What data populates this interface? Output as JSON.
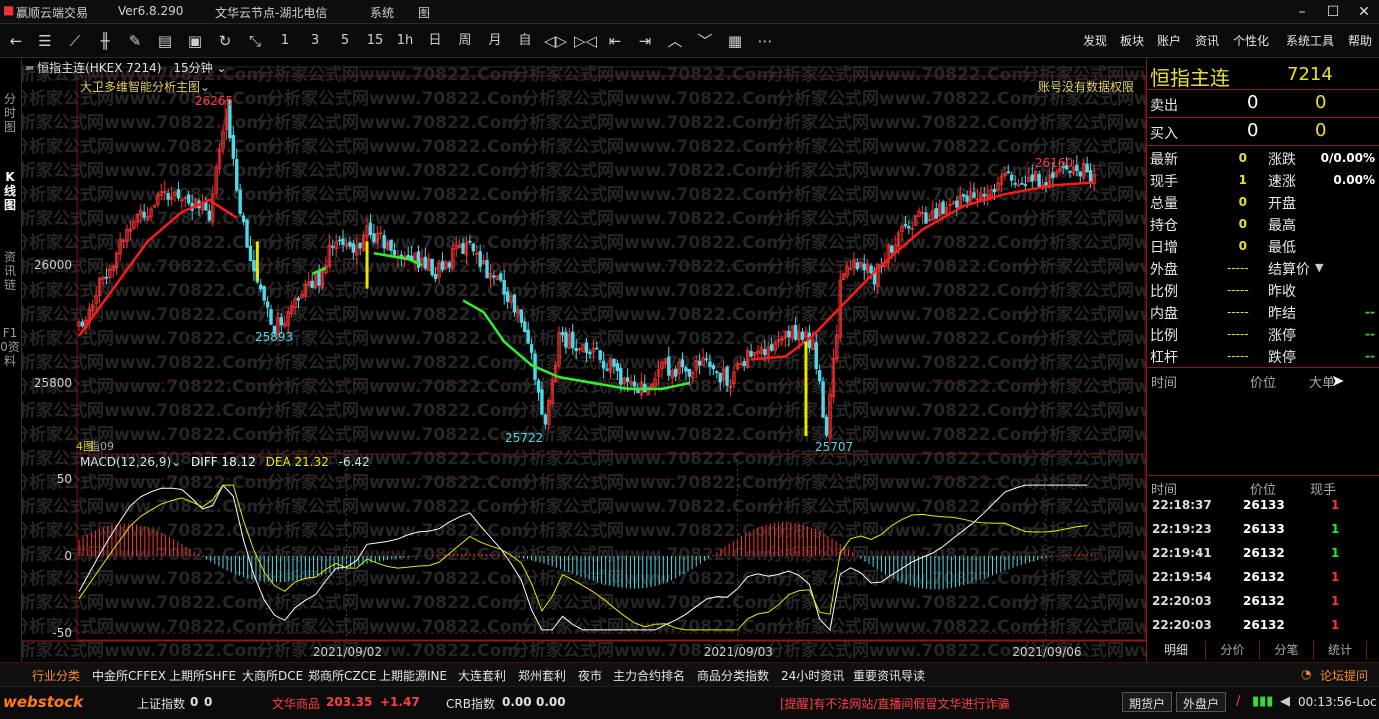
{
  "titlebar": {
    "app_name": "赢顺云端交易",
    "version": "Ver6.8.290",
    "server": "文华云节点-湖北电信",
    "menu": "系统  &   图",
    "menu_text": "系统 　图"
  },
  "toolbar": {
    "periods": [
      "1",
      "3",
      "5",
      "15",
      "1h",
      "日",
      "周",
      "月",
      "自"
    ],
    "menus": [
      "发现",
      "板块",
      "账户",
      "资讯",
      "个性化",
      "系统工具",
      "帮助"
    ]
  },
  "left_tabs": [
    "分时图",
    "K线图",
    "资讯链",
    "F10资料"
  ],
  "chart_header": {
    "symbol": "恒指主连(HKEX 7214)",
    "period": "15分钟"
  },
  "main_chart": {
    "indicator": "大卫多维智能分析主图",
    "notice": "账号没有数据权限",
    "y_ticks": [
      "26000",
      "25800"
    ],
    "labels": {
      "high1": "26265",
      "high2": "26160",
      "low1": "25893",
      "low2": "25722",
      "low3": "25707"
    },
    "sub_label": "4图",
    "sub_label2": "指09"
  },
  "macd": {
    "name": "MACD(12,26,9)",
    "diff": "DIFF 18.12",
    "dea": "DEA 21.32",
    "macd_val": "-6.42",
    "y_ticks": [
      "50",
      "0",
      "-50"
    ]
  },
  "x_axis": [
    "2021/09/02",
    "2021/09/03",
    "2021/09/06"
  ],
  "quote_panel": {
    "name": "恒指主连",
    "code": "7214",
    "sell_label": "卖出",
    "sell_price": "0",
    "sell_vol": "0",
    "buy_label": "买入",
    "buy_price": "0",
    "buy_vol": "0",
    "left": [
      {
        "label": "最新",
        "value": "0"
      },
      {
        "label": "现手",
        "value": "1"
      },
      {
        "label": "总量",
        "value": "0"
      },
      {
        "label": "持仓",
        "value": "0"
      },
      {
        "label": "日增",
        "value": "0"
      },
      {
        "label": "外盘",
        "value": "-----"
      },
      {
        "label": "比例",
        "value": "-----"
      },
      {
        "label": "内盘",
        "value": "-----"
      },
      {
        "label": "比例",
        "value": "-----"
      },
      {
        "label": "杠杆",
        "value": "-----"
      }
    ],
    "right": [
      {
        "label": "涨跌",
        "value": "0/0.00%"
      },
      {
        "label": "速涨",
        "value": "0.00%"
      },
      {
        "label": "开盘",
        "value": ""
      },
      {
        "label": "最高",
        "value": ""
      },
      {
        "label": "最低",
        "value": ""
      },
      {
        "label": "结算价",
        "value": ""
      },
      {
        "label": "昨收",
        "value": ""
      },
      {
        "label": "昨结",
        "value": "--"
      },
      {
        "label": "涨停",
        "value": "--"
      },
      {
        "label": "跌停",
        "value": "--"
      }
    ],
    "big_header": [
      "时间",
      "价位",
      "大单"
    ],
    "tick_header": [
      "时间",
      "价位",
      "现手"
    ],
    "ticks": [
      {
        "time": "22:18:37",
        "price": "26133",
        "vol": "1",
        "color": "#ff3030"
      },
      {
        "time": "22:19:23",
        "price": "26133",
        "vol": "1",
        "color": "#2ee52e"
      },
      {
        "time": "22:19:41",
        "price": "26132",
        "vol": "1",
        "color": "#2ee52e"
      },
      {
        "time": "22:19:54",
        "price": "26132",
        "vol": "1",
        "color": "#ff3030"
      },
      {
        "time": "22:20:03",
        "price": "26132",
        "vol": "1",
        "color": "#ff3030"
      },
      {
        "time": "22:20:03",
        "price": "26132",
        "vol": "1",
        "color": "#ff3030"
      }
    ],
    "tabs": [
      "明细",
      "分价",
      "分笔",
      "统计"
    ]
  },
  "bottom_bar": [
    "行业分类",
    "中金所CFFEX",
    "上期所SHFE",
    "大商所DCE",
    "郑商所CZCE",
    "上期能源INE",
    "大连套利",
    "郑州套利",
    "夜市",
    "主力合约排名",
    "商品分类指数",
    "24小时资讯",
    "重要资讯导读"
  ],
  "bottom_right": "论坛提问",
  "status": {
    "logo": "webstock",
    "idx1_name": "上证指数",
    "idx1_v1": "0",
    "idx1_v2": "0",
    "idx2_name": "文华商品",
    "idx2_v1": "203.35",
    "idx2_v2": "+1.47",
    "idx3_name": "CRB指数",
    "idx3_v1": "0.00",
    "idx3_v2": "0.00",
    "warning": "[提醒]有不法网站/直播间假冒文华进行诈骗",
    "btn1": "期货户",
    "btn2": "外盘户",
    "clock": "00:13:56-Loc"
  },
  "watermark": "分析家公式网www.70822.Com",
  "colors": {
    "up": "#ff3232",
    "down": "#4fd8e8",
    "ma_red": "#ff1a1a",
    "ma_green": "#33ee33",
    "panel_border": "#8b1a1a"
  },
  "chart_data": {
    "type": "candlestick",
    "title": "恒指主连(HKEX 7214) 15分钟",
    "y_ticks": [
      26000,
      25800
    ],
    "x_ticks": [
      "2021/09/02",
      "2021/09/03",
      "2021/09/06"
    ],
    "annotated_high": [
      26265,
      26160
    ],
    "annotated_low": [
      25893,
      25722,
      25707
    ],
    "macd": {
      "diff": 18.12,
      "dea": 21.32,
      "macd": -6.42,
      "y_ticks": [
        50,
        0,
        -50
      ]
    },
    "main_price_path": [
      [
        0,
        25895
      ],
      [
        8,
        25990
      ],
      [
        16,
        26080
      ],
      [
        24,
        26110
      ],
      [
        30,
        26120
      ],
      [
        38,
        26080
      ],
      [
        43,
        26265
      ],
      [
        47,
        26100
      ],
      [
        52,
        25960
      ],
      [
        56,
        25900
      ],
      [
        60,
        25893
      ],
      [
        64,
        25950
      ],
      [
        70,
        25980
      ],
      [
        74,
        26040
      ],
      [
        80,
        26020
      ],
      [
        84,
        26060
      ],
      [
        88,
        26040
      ],
      [
        92,
        26020
      ],
      [
        98,
        26010
      ],
      [
        104,
        25990
      ],
      [
        110,
        26020
      ],
      [
        114,
        26040
      ],
      [
        118,
        26000
      ],
      [
        124,
        25960
      ],
      [
        130,
        25900
      ],
      [
        136,
        25722
      ],
      [
        140,
        25880
      ],
      [
        146,
        25860
      ],
      [
        152,
        25840
      ],
      [
        158,
        25810
      ],
      [
        164,
        25790
      ],
      [
        170,
        25830
      ],
      [
        176,
        25820
      ],
      [
        184,
        25830
      ],
      [
        190,
        25800
      ],
      [
        196,
        25860
      ],
      [
        202,
        25850
      ],
      [
        208,
        25890
      ],
      [
        214,
        25870
      ],
      [
        218,
        25707
      ],
      [
        222,
        25960
      ],
      [
        226,
        26010
      ],
      [
        232,
        25980
      ],
      [
        238,
        26040
      ],
      [
        244,
        26080
      ],
      [
        250,
        26090
      ],
      [
        256,
        26110
      ],
      [
        262,
        26120
      ],
      [
        270,
        26150
      ],
      [
        276,
        26140
      ],
      [
        284,
        26150
      ],
      [
        290,
        26160
      ],
      [
        296,
        26155
      ]
    ],
    "ma_red_path": [
      [
        0,
        25880
      ],
      [
        10,
        25960
      ],
      [
        20,
        26040
      ],
      [
        30,
        26090
      ],
      [
        38,
        26110
      ],
      [
        46,
        26080
      ]
    ],
    "ma_green_path": [
      [
        112,
        25940
      ],
      [
        118,
        25920
      ],
      [
        124,
        25870
      ],
      [
        132,
        25830
      ],
      [
        140,
        25810
      ],
      [
        150,
        25800
      ],
      [
        160,
        25790
      ],
      [
        170,
        25790
      ],
      [
        178,
        25800
      ]
    ],
    "ma_red_path2": [
      [
        196,
        25840
      ],
      [
        206,
        25845
      ],
      [
        214,
        25880
      ],
      [
        224,
        25940
      ],
      [
        234,
        26000
      ],
      [
        246,
        26060
      ],
      [
        258,
        26100
      ],
      [
        270,
        26120
      ],
      [
        284,
        26135
      ],
      [
        296,
        26140
      ]
    ]
  }
}
